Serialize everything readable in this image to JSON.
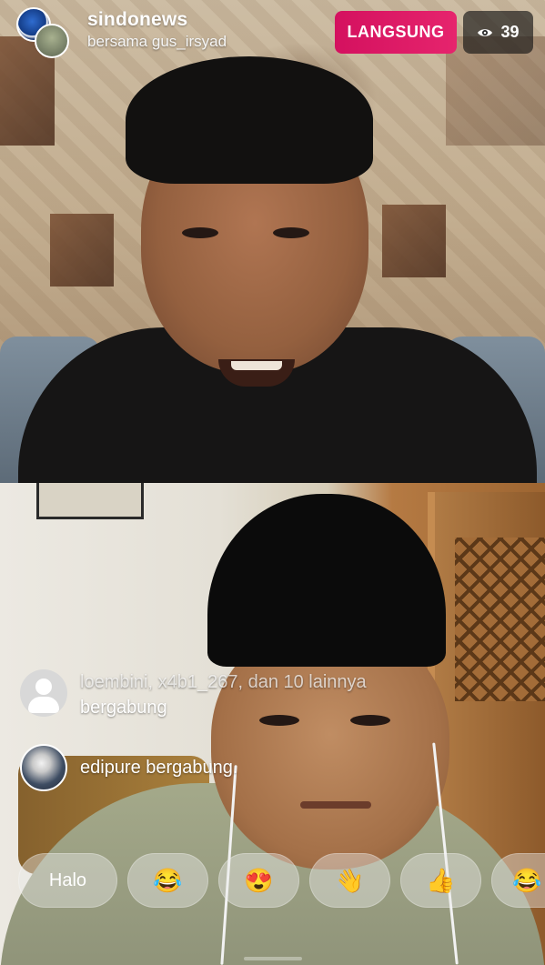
{
  "host": {
    "username": "sindonews",
    "subtitle": "bersama gus_irsyad"
  },
  "live_badge": {
    "label": "LANGSUNG",
    "color": "#d4115f"
  },
  "viewers": {
    "icon": "eye-icon",
    "count": "39"
  },
  "join_notices": [
    {
      "names": "loembini, x4b1_267, dan 10 lainnya",
      "action": "bergabung",
      "avatar": "default-avatar-icon"
    },
    {
      "text": "edipure bergabung."
    }
  ],
  "quick_replies": [
    {
      "type": "text",
      "label": "Halo"
    },
    {
      "type": "emoji",
      "label": "😂",
      "name": "laughing-emoji"
    },
    {
      "type": "emoji",
      "label": "😍",
      "name": "heart-eyes-emoji"
    },
    {
      "type": "emoji",
      "label": "👋",
      "name": "waving-hand-emoji"
    },
    {
      "type": "emoji",
      "label": "👍",
      "name": "thumbs-up-emoji"
    },
    {
      "type": "emoji",
      "label": "😂",
      "name": "laughing-emoji"
    }
  ]
}
